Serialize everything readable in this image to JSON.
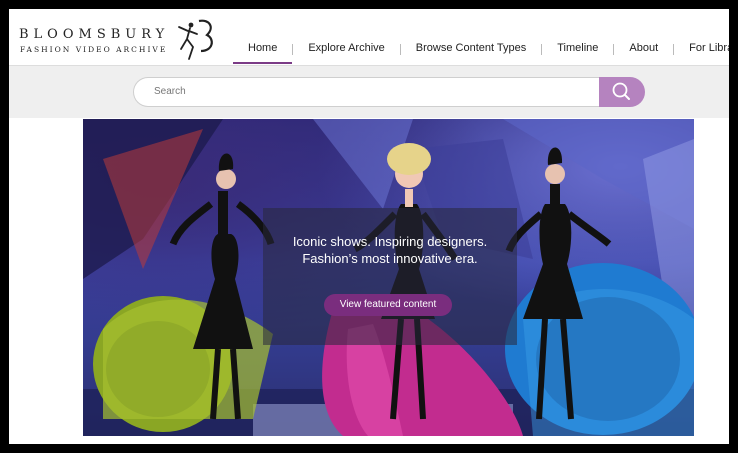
{
  "header": {
    "brand": "BLOOMSBURY",
    "subtitle": "FASHION VIDEO ARCHIVE",
    "logo_icon": "dancer-figure-icon"
  },
  "nav": {
    "items": [
      {
        "label": "Home",
        "active": true
      },
      {
        "label": "Explore Archive",
        "active": false
      },
      {
        "label": "Browse Content Types",
        "active": false
      },
      {
        "label": "Timeline",
        "active": false
      },
      {
        "label": "About",
        "active": false
      },
      {
        "label": "For Librarians",
        "active": false
      }
    ]
  },
  "search": {
    "placeholder": "Search",
    "button_icon": "search-icon"
  },
  "hero": {
    "line1": "Iconic shows. Inspiring designers.",
    "line2": "Fashion’s most innovative era.",
    "button_label": "View featured content"
  },
  "colors": {
    "accent": "#7a2d7e",
    "search_button": "#b583bf",
    "active_nav_underline": "#7b3b86"
  }
}
